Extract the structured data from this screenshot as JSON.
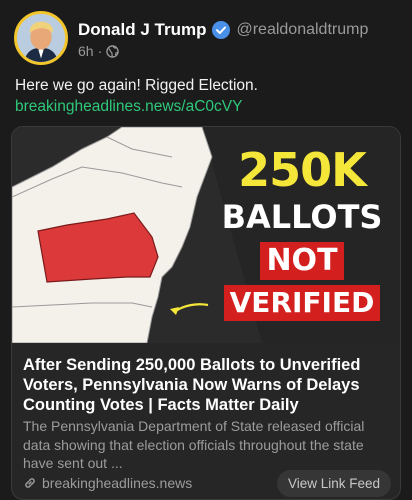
{
  "author": {
    "name": "Donald J Trump",
    "handle": "@realdonaldtrump",
    "time": "6h",
    "separator": "·"
  },
  "post": {
    "text_before_link": "Here we go again! Rigged Election.",
    "link_text": "breakingheadlines.news/aC0cVY"
  },
  "card": {
    "image": {
      "line1": "250K",
      "line2": "BALLOTS",
      "line3": "NOT",
      "line4": "VERIFIED"
    },
    "title": "After Sending 250,000 Ballots to Unverified Voters, Pennsylvania Now Warns of Delays Counting Votes | Facts Matter Daily",
    "description": "The Pennsylvania Department of State released official data showing that election officials throughout the state have sent out ...",
    "domain": "breakingheadlines.news",
    "view_button": "View Link Feed"
  },
  "icons": {
    "verified": "verified-badge-icon",
    "globe": "globe-icon",
    "link": "link-icon"
  },
  "colors": {
    "background": "#1b1b1b",
    "card": "#262626",
    "link": "#2fc87a",
    "verified": "#4a8fe8",
    "avatar_ring": "#f2c52a",
    "highlight_yellow": "#f5e63a",
    "highlight_red": "#d41f1f",
    "map_highlight": "#dc3a3a"
  }
}
